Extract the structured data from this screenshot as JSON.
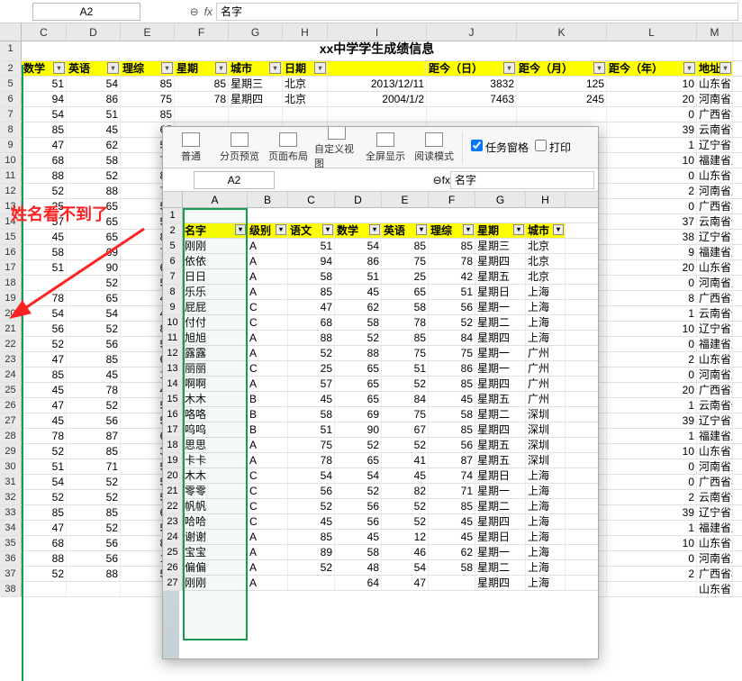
{
  "top": {
    "namebox": "A2",
    "fx_reset": "⊖",
    "fx": "fx",
    "formula": "名字"
  },
  "annotation": "姓名看不到了",
  "title": "xx中学学生成绩信息",
  "main_cols": [
    "C",
    "D",
    "E",
    "F",
    "G",
    "H",
    "I",
    "J",
    "K",
    "L",
    "M"
  ],
  "main_widths": [
    50,
    60,
    60,
    60,
    60,
    50,
    110,
    100,
    100,
    100,
    40
  ],
  "main_headers": [
    "数学",
    "英语",
    "理综",
    "星期",
    "城市",
    "日期",
    "",
    "距今（日）",
    "距今（月）",
    "距今（年）",
    "地址"
  ],
  "main_rows": [
    {
      "n": 5,
      "v": [
        "51",
        "54",
        "85",
        "85",
        "星期三",
        "北京",
        "2013/12/11",
        "3832",
        "125",
        "10",
        "山东省青岛市"
      ]
    },
    {
      "n": 6,
      "v": [
        "94",
        "86",
        "75",
        "78",
        "星期四",
        "北京",
        "2004/1/2",
        "7463",
        "245",
        "20",
        "河南省周口市"
      ]
    },
    {
      "n": 7,
      "v": [
        "54",
        "51",
        "85",
        "",
        "",
        "",
        "",
        "",
        "",
        "0",
        "广西省柳州市"
      ]
    },
    {
      "n": 8,
      "v": [
        "85",
        "45",
        "65",
        "",
        "",
        "",
        "",
        "",
        "",
        "39",
        "云南省保山市"
      ]
    },
    {
      "n": 9,
      "v": [
        "47",
        "62",
        "58",
        "",
        "",
        "",
        "",
        "",
        "",
        "1",
        "辽宁省本溪市"
      ]
    },
    {
      "n": 10,
      "v": [
        "68",
        "58",
        "78",
        "",
        "",
        "",
        "",
        "",
        "",
        "10",
        "福建省厦门市"
      ]
    },
    {
      "n": 11,
      "v": [
        "88",
        "52",
        "85",
        "",
        "",
        "",
        "",
        "",
        "",
        "0",
        "山东省青岛市"
      ]
    },
    {
      "n": 12,
      "v": [
        "52",
        "88",
        "75",
        "",
        "",
        "",
        "",
        "",
        "",
        "2",
        "河南省周口市"
      ]
    },
    {
      "n": 13,
      "v": [
        "25",
        "65",
        "51",
        "",
        "",
        "",
        "",
        "",
        "",
        "0",
        "广西省柳州市"
      ]
    },
    {
      "n": 14,
      "v": [
        "57",
        "65",
        "52",
        "",
        "",
        "",
        "",
        "",
        "",
        "37",
        "云南省保山市"
      ]
    },
    {
      "n": 15,
      "v": [
        "45",
        "65",
        "84",
        "",
        "",
        "",
        "",
        "",
        "",
        "38",
        "辽宁省本溪市"
      ]
    },
    {
      "n": 16,
      "v": [
        "58",
        "69",
        "75",
        "",
        "",
        "",
        "",
        "",
        "",
        "9",
        "福建省厦门市"
      ]
    },
    {
      "n": 17,
      "v": [
        "51",
        "90",
        "67",
        "",
        "",
        "",
        "",
        "",
        "",
        "20",
        "山东省青岛市"
      ]
    },
    {
      "n": 18,
      "v": [
        "",
        "52",
        "52",
        "",
        "",
        "",
        "",
        "",
        "",
        "0",
        "河南省周口市"
      ]
    },
    {
      "n": 19,
      "v": [
        "78",
        "65",
        "41",
        "",
        "",
        "",
        "",
        "",
        "",
        "8",
        "广西省柳州市"
      ]
    },
    {
      "n": 20,
      "v": [
        "54",
        "54",
        "45",
        "",
        "",
        "",
        "",
        "",
        "",
        "1",
        "云南省保山市"
      ]
    },
    {
      "n": 21,
      "v": [
        "56",
        "52",
        "82",
        "",
        "",
        "",
        "",
        "",
        "",
        "10",
        "辽宁省本溪市"
      ]
    },
    {
      "n": 22,
      "v": [
        "52",
        "56",
        "52",
        "",
        "",
        "",
        "",
        "",
        "",
        "0",
        "福建省厦门市"
      ]
    },
    {
      "n": 23,
      "v": [
        "47",
        "85",
        "65",
        "",
        "",
        "",
        "",
        "",
        "",
        "2",
        "山东省青岛市"
      ]
    },
    {
      "n": 24,
      "v": [
        "85",
        "45",
        "12",
        "",
        "",
        "",
        "",
        "",
        "",
        "0",
        "河南省周口市"
      ]
    },
    {
      "n": 25,
      "v": [
        "45",
        "78",
        "47",
        "",
        "",
        "",
        "",
        "",
        "",
        "20",
        "广西省柳州市"
      ]
    },
    {
      "n": 26,
      "v": [
        "47",
        "52",
        "52",
        "",
        "",
        "",
        "",
        "",
        "",
        "1",
        "云南省保山市"
      ]
    },
    {
      "n": 27,
      "v": [
        "45",
        "56",
        "54",
        "",
        "",
        "",
        "",
        "",
        "",
        "39",
        "辽宁省本溪市"
      ]
    },
    {
      "n": 28,
      "v": [
        "78",
        "87",
        "65",
        "",
        "",
        "",
        "",
        "",
        "",
        "1",
        "福建省厦门市"
      ]
    },
    {
      "n": 29,
      "v": [
        "52",
        "85",
        "35",
        "",
        "",
        "",
        "",
        "",
        "",
        "10",
        "山东省青岛市"
      ]
    },
    {
      "n": 30,
      "v": [
        "51",
        "71",
        "51",
        "",
        "",
        "",
        "",
        "",
        "",
        "0",
        "河南省周口市"
      ]
    },
    {
      "n": 31,
      "v": [
        "54",
        "52",
        "54",
        "",
        "",
        "",
        "",
        "",
        "",
        "0",
        "广西省柳州市"
      ]
    },
    {
      "n": 32,
      "v": [
        "52",
        "52",
        "54",
        "",
        "",
        "",
        "",
        "",
        "",
        "2",
        "云南省保山市"
      ]
    },
    {
      "n": 33,
      "v": [
        "85",
        "85",
        "62",
        "",
        "",
        "",
        "",
        "",
        "",
        "39",
        "辽宁省本溪市"
      ]
    },
    {
      "n": 34,
      "v": [
        "47",
        "52",
        "52",
        "",
        "",
        "",
        "",
        "",
        "",
        "1",
        "福建省厦门市"
      ]
    },
    {
      "n": 35,
      "v": [
        "68",
        "56",
        "85",
        "",
        "",
        "",
        "",
        "",
        "",
        "10",
        "山东省青岛市"
      ]
    },
    {
      "n": 36,
      "v": [
        "88",
        "56",
        "14",
        "",
        "",
        "",
        "",
        "",
        "",
        "0",
        "河南省周口市"
      ]
    },
    {
      "n": 37,
      "v": [
        "52",
        "88",
        "51",
        "",
        "",
        "",
        "",
        "",
        "",
        "2",
        "广西省柳州市"
      ]
    },
    {
      "n": 38,
      "v": [
        "",
        "",
        "",
        "",
        "",
        "",
        "",
        "",
        "",
        "",
        "山东省青岛市"
      ]
    }
  ],
  "win2": {
    "ribbon": [
      "普通",
      "分页预览",
      "页面布局",
      "自定义视图",
      "全屏显示",
      "阅读模式"
    ],
    "chk1": "任务窗格",
    "chk2": "打印",
    "namebox": "A2",
    "fx": "fx",
    "formula": "名字",
    "cols": [
      "A",
      "B",
      "C",
      "D",
      "E",
      "F",
      "G",
      "H"
    ],
    "widths": [
      72,
      45,
      52,
      52,
      52,
      52,
      56,
      44
    ],
    "headers": [
      "名字",
      "级别",
      "语文",
      "数学",
      "英语",
      "理综",
      "星期",
      "城市"
    ],
    "rows": [
      {
        "n": 5,
        "v": [
          "刚刚",
          "A",
          "51",
          "54",
          "85",
          "85",
          "星期三",
          "北京"
        ]
      },
      {
        "n": 6,
        "v": [
          "依依",
          "A",
          "94",
          "86",
          "75",
          "78",
          "星期四",
          "北京"
        ]
      },
      {
        "n": 7,
        "v": [
          "日日",
          "A",
          "58",
          "51",
          "25",
          "42",
          "星期五",
          "北京"
        ]
      },
      {
        "n": 8,
        "v": [
          "乐乐",
          "A",
          "85",
          "45",
          "65",
          "51",
          "星期日",
          "上海"
        ]
      },
      {
        "n": 9,
        "v": [
          "屁屁",
          "C",
          "47",
          "62",
          "58",
          "56",
          "星期一",
          "上海"
        ]
      },
      {
        "n": 10,
        "v": [
          "付付",
          "C",
          "68",
          "58",
          "78",
          "52",
          "星期二",
          "上海"
        ]
      },
      {
        "n": 11,
        "v": [
          "旭旭",
          "A",
          "88",
          "52",
          "85",
          "84",
          "星期四",
          "上海"
        ]
      },
      {
        "n": 12,
        "v": [
          "露露",
          "A",
          "52",
          "88",
          "75",
          "75",
          "星期一",
          "广州"
        ]
      },
      {
        "n": 13,
        "v": [
          "丽丽",
          "C",
          "25",
          "65",
          "51",
          "86",
          "星期一",
          "广州"
        ]
      },
      {
        "n": 14,
        "v": [
          "啊啊",
          "A",
          "57",
          "65",
          "52",
          "85",
          "星期四",
          "广州"
        ]
      },
      {
        "n": 15,
        "v": [
          "木木",
          "B",
          "45",
          "65",
          "84",
          "45",
          "星期五",
          "广州"
        ]
      },
      {
        "n": 16,
        "v": [
          "咯咯",
          "B",
          "58",
          "69",
          "75",
          "58",
          "星期二",
          "深圳"
        ]
      },
      {
        "n": 17,
        "v": [
          "呜呜",
          "B",
          "51",
          "90",
          "67",
          "85",
          "星期四",
          "深圳"
        ]
      },
      {
        "n": 18,
        "v": [
          "思思",
          "A",
          "75",
          "52",
          "52",
          "56",
          "星期五",
          "深圳"
        ]
      },
      {
        "n": 19,
        "v": [
          "卡卡",
          "A",
          "78",
          "65",
          "41",
          "87",
          "星期五",
          "深圳"
        ]
      },
      {
        "n": 20,
        "v": [
          "木木",
          "C",
          "54",
          "54",
          "45",
          "74",
          "星期日",
          "上海"
        ]
      },
      {
        "n": 21,
        "v": [
          "零零",
          "C",
          "56",
          "52",
          "82",
          "71",
          "星期一",
          "上海"
        ]
      },
      {
        "n": 22,
        "v": [
          "帆帆",
          "C",
          "52",
          "56",
          "52",
          "85",
          "星期二",
          "上海"
        ]
      },
      {
        "n": 23,
        "v": [
          "哈哈",
          "C",
          "45",
          "56",
          "52",
          "45",
          "星期四",
          "上海"
        ]
      },
      {
        "n": 24,
        "v": [
          "谢谢",
          "A",
          "85",
          "45",
          "12",
          "45",
          "星期日",
          "上海"
        ]
      },
      {
        "n": 25,
        "v": [
          "宝宝",
          "A",
          "89",
          "58",
          "46",
          "62",
          "星期一",
          "上海"
        ]
      },
      {
        "n": 26,
        "v": [
          "偏偏",
          "A",
          "52",
          "48",
          "54",
          "58",
          "星期二",
          "上海"
        ]
      },
      {
        "n": 27,
        "v": [
          "刚刚",
          "A",
          "",
          "64",
          "47",
          "",
          "星期四",
          "上海"
        ]
      }
    ]
  }
}
